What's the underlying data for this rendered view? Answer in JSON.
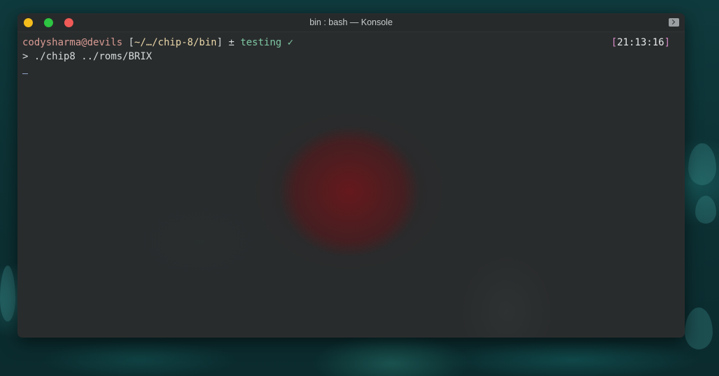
{
  "window": {
    "title": "bin : bash — Konsole"
  },
  "prompt": {
    "user_host": "codysharma@devils",
    "bracket_open": "[",
    "path": "~/…/chip-8/bin",
    "bracket_close": "]",
    "git_symbol": "±",
    "branch": "testing",
    "status": "✓",
    "time_open": "[",
    "time": "21:13:16",
    "time_close": "]"
  },
  "command": {
    "prompt_char": ">",
    "text": "./chip8 ../roms/BRIX"
  },
  "icons": {
    "titlebar_right": "terminal-icon",
    "window_controls": [
      "minimize-icon",
      "maximize-icon",
      "close-icon"
    ]
  },
  "colors": {
    "minimize": "#f5bd1c",
    "maximize": "#2dc542",
    "close": "#f05a57",
    "user_host": "#d89b94",
    "branch": "#7fc8a4",
    "time_bracket": "#d78ac7"
  }
}
